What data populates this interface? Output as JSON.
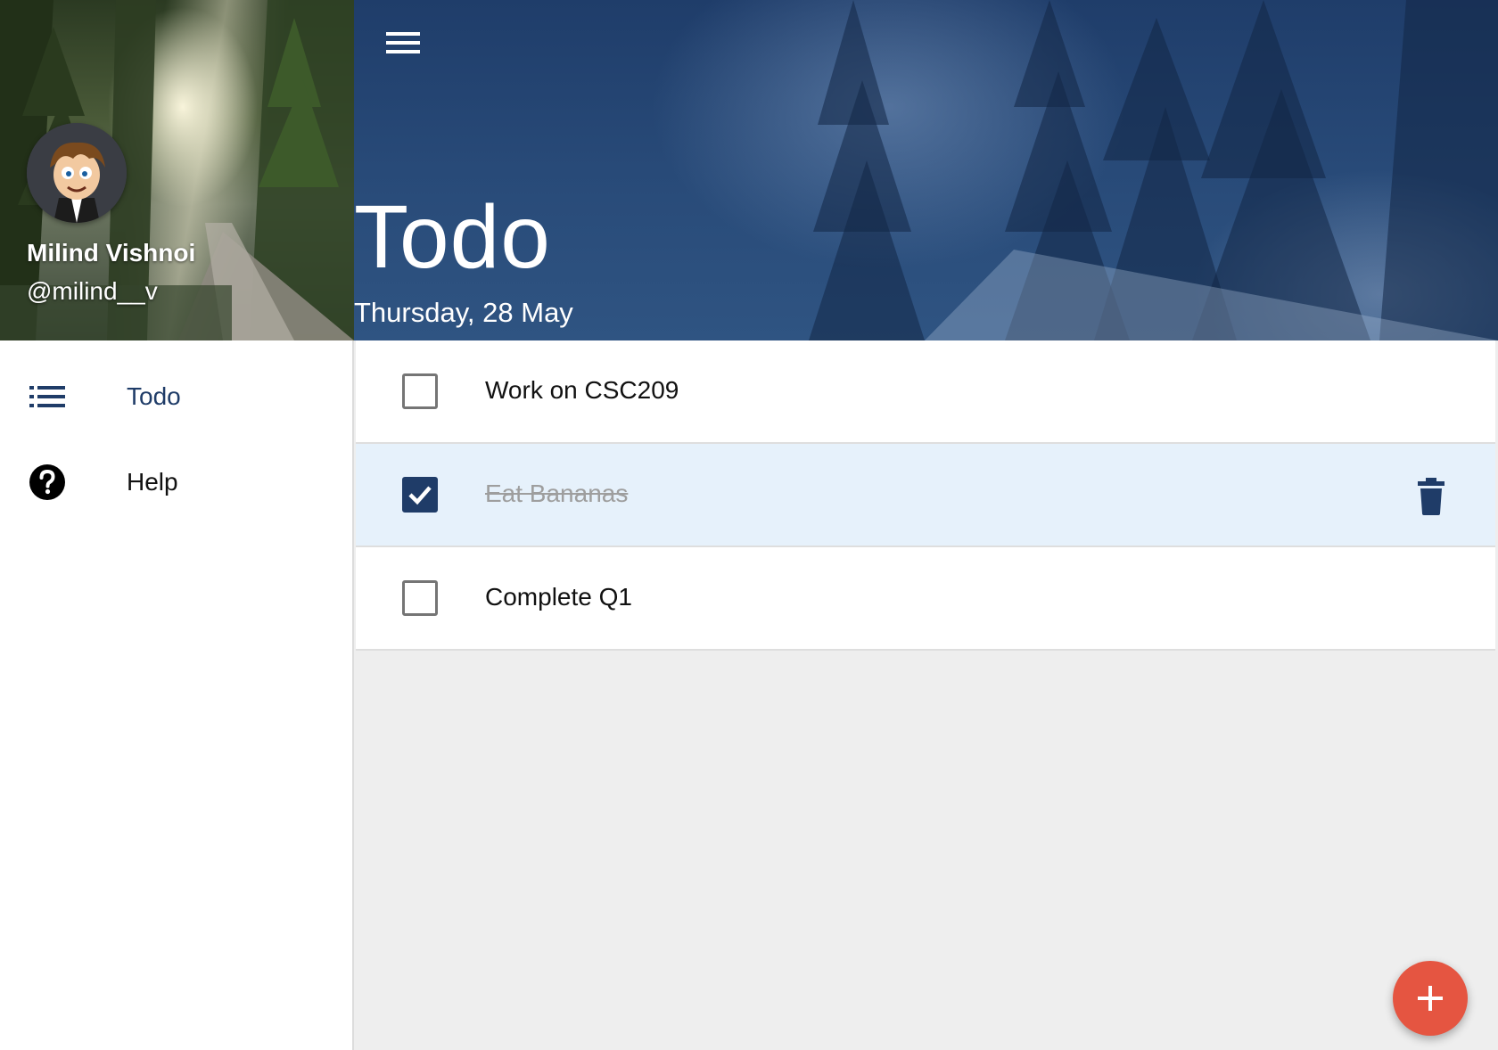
{
  "drawer": {
    "user": {
      "name": "Milind Vishnoi",
      "handle": "@milind__v"
    },
    "nav": [
      {
        "label": "Todo",
        "icon": "list-icon",
        "active": true
      },
      {
        "label": "Help",
        "icon": "help-circle-icon",
        "active": false
      }
    ]
  },
  "header": {
    "menu_icon": "menu-icon",
    "title": "Todo",
    "date": "Thursday, 28 May"
  },
  "todos": [
    {
      "text": "Work on CSC209",
      "done": false
    },
    {
      "text": "Eat Bananas",
      "done": true,
      "action_icon": "trash-icon"
    },
    {
      "text": "Complete Q1",
      "done": false
    }
  ],
  "fab": {
    "icon": "plus-icon"
  },
  "colors": {
    "primary": "#1f3c68",
    "accent": "#e55541",
    "completed_row": "#e6f1fb",
    "background": "#eeeeee"
  }
}
